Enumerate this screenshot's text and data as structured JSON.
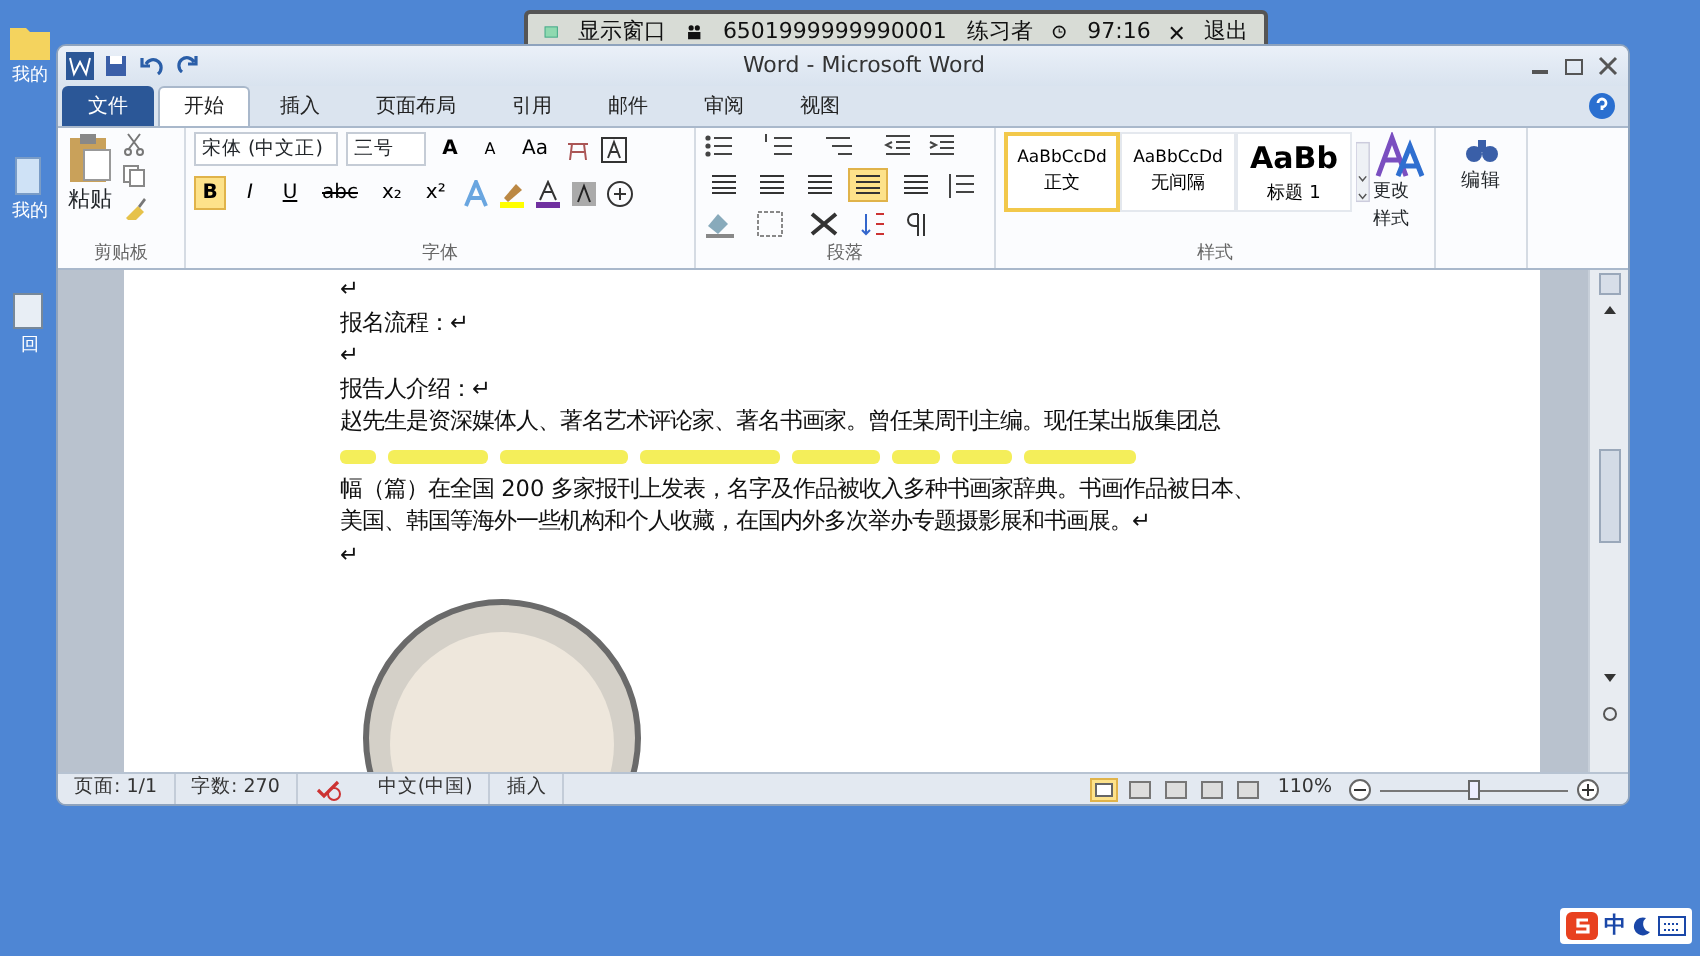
{
  "exam_bar": {
    "show_window": "显示窗口",
    "exam_id": "6501999999990001",
    "user": "练习者",
    "time": "97:16",
    "exit": "退出"
  },
  "desktop_icons": [
    {
      "label": "我的"
    },
    {
      "label": "我的"
    },
    {
      "label": "回"
    }
  ],
  "window": {
    "title": "Word - Microsoft Word"
  },
  "tabs": [
    {
      "label": "文件",
      "kind": "file",
      "selected": false
    },
    {
      "label": "开始",
      "kind": "tab",
      "selected": true
    },
    {
      "label": "插入",
      "kind": "tab",
      "selected": false
    },
    {
      "label": "页面布局",
      "kind": "tab",
      "selected": false
    },
    {
      "label": "引用",
      "kind": "tab",
      "selected": false
    },
    {
      "label": "邮件",
      "kind": "tab",
      "selected": false
    },
    {
      "label": "审阅",
      "kind": "tab",
      "selected": false
    },
    {
      "label": "视图",
      "kind": "tab",
      "selected": false
    }
  ],
  "ribbon": {
    "clipboard": {
      "label": "剪贴板",
      "paste": "粘贴"
    },
    "font": {
      "label": "字体",
      "font_name": "宋体 (中文正)",
      "font_size": "三号",
      "grow": "A",
      "shrink": "A",
      "case": "Aa",
      "format_buttons": [
        {
          "label": "B",
          "on": true
        },
        {
          "label": "I",
          "on": false
        },
        {
          "label": "U",
          "on": false
        },
        {
          "label": "abc",
          "on": false
        },
        {
          "label": "x₂",
          "on": false
        },
        {
          "label": "x²",
          "on": false
        }
      ]
    },
    "paragraph": {
      "label": "段落",
      "alignments": [
        {
          "selected": false
        },
        {
          "selected": false
        },
        {
          "selected": false
        },
        {
          "selected": true
        },
        {
          "selected": false
        }
      ]
    },
    "styles": {
      "label": "样式",
      "items": [
        {
          "sample": "AaBbCcDd",
          "name": "正文",
          "selected": true,
          "kind": "small"
        },
        {
          "sample": "AaBbCcDd",
          "name": "无间隔",
          "selected": false,
          "kind": "small"
        },
        {
          "sample": "AaBb",
          "name": "标题 1",
          "selected": false,
          "kind": "large"
        }
      ],
      "change": "更改样式"
    },
    "editing": {
      "button": "编辑"
    }
  },
  "document": {
    "lines": [
      {
        "kind": "text",
        "text": "↵"
      },
      {
        "kind": "text",
        "text": "报名流程：↵"
      },
      {
        "kind": "text",
        "text": "↵"
      },
      {
        "kind": "text",
        "text": "报告人介绍：↵"
      },
      {
        "kind": "text",
        "text": "赵先生是资深媒体人、著名艺术评论家、著名书画家。曾任某周刊主编。现任某出版集团总"
      },
      {
        "kind": "highlight"
      },
      {
        "kind": "text",
        "text": "幅（篇）在全国 200 多家报刊上发表，名字及作品被收入多种书画家辞典。书画作品被日本、"
      },
      {
        "kind": "text",
        "text": "美国、韩国等海外一些机构和个人收藏，在国内外多次举办专题摄影展和书画展。↵"
      },
      {
        "kind": "text",
        "text": "↵"
      }
    ]
  },
  "status_bar": {
    "page": "页面: 1/1",
    "words": "字数: 270",
    "language": "中文(中国)",
    "mode": "插入",
    "zoom": "110%",
    "zoom_slider": {
      "level": 0.5
    }
  },
  "ime": {
    "label": "中"
  }
}
